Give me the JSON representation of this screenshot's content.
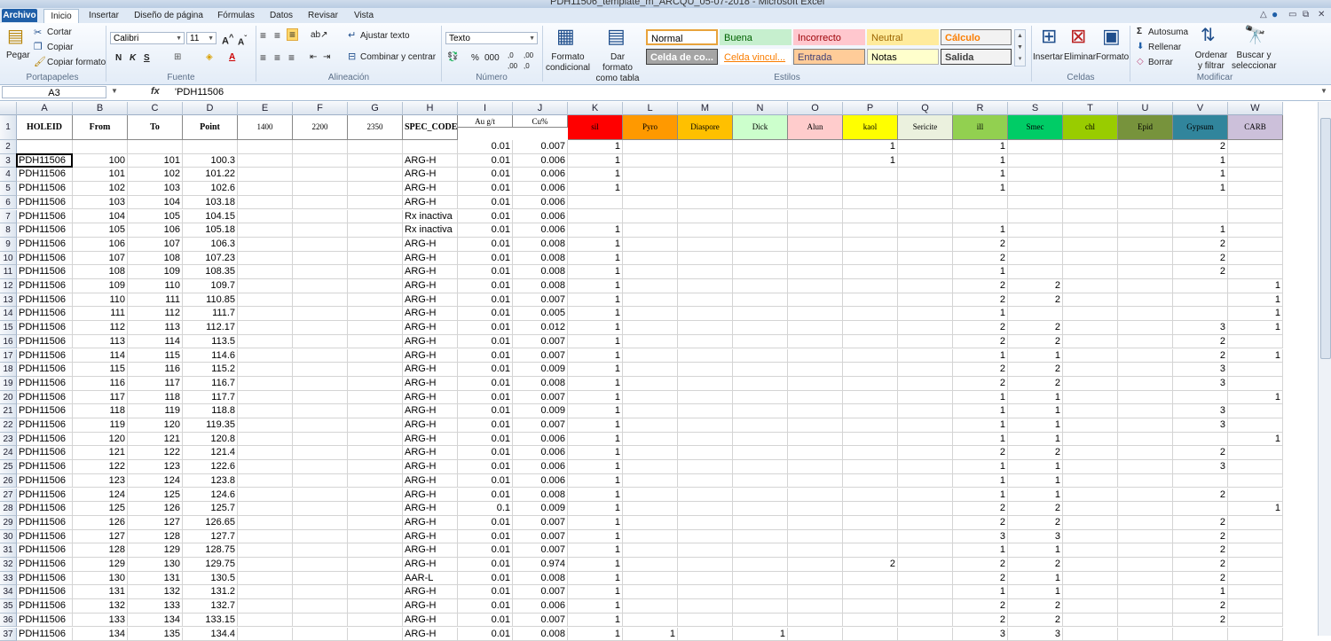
{
  "window": {
    "title": "PDH11506_template_m_ARCQU_05-07-2018 - Microsoft Excel"
  },
  "ribbon_tabs": [
    "Archivo",
    "Inicio",
    "Insertar",
    "Diseño de página",
    "Fórmulas",
    "Datos",
    "Revisar",
    "Vista"
  ],
  "ribbon": {
    "clipboard": {
      "paste": "Pegar",
      "cut": "Cortar",
      "copy": "Copiar",
      "format_painter": "Copiar formato",
      "group": "Portapapeles"
    },
    "font": {
      "name": "Calibri",
      "size": "11",
      "group": "Fuente"
    },
    "alignment": {
      "wrap": "Ajustar texto",
      "merge": "Combinar y centrar",
      "group": "Alineación"
    },
    "number": {
      "format": "Texto",
      "percent": "%",
      "thousands": "000",
      "group": "Número"
    },
    "styles": {
      "cond_format": "Formato condicional",
      "table_format": "Dar formato como tabla",
      "group": "Estilos",
      "cells": [
        {
          "label": "Normal",
          "bg": "#ffffff",
          "fg": "#000000",
          "border": "#e8a33c"
        },
        {
          "label": "Buena",
          "bg": "#c6efce",
          "fg": "#006100",
          "border": "#c6efce"
        },
        {
          "label": "Incorrecto",
          "bg": "#ffc7ce",
          "fg": "#9c0006",
          "border": "#ffc7ce"
        },
        {
          "label": "Neutral",
          "bg": "#ffeb9c",
          "fg": "#9c6500",
          "border": "#ffeb9c"
        },
        {
          "label": "Cálculo",
          "bg": "#f2f2f2",
          "fg": "#fa7d00",
          "border": "#7f7f7f"
        },
        {
          "label": "Celda de co...",
          "bg": "#a5a5a5",
          "fg": "#ffffff",
          "border": "#3f3f3f"
        },
        {
          "label": "Celda vincul...",
          "bg": "#ffffff",
          "fg": "#fa7d00",
          "border": "#ffffff"
        },
        {
          "label": "Entrada",
          "bg": "#ffcc99",
          "fg": "#3f3f76",
          "border": "#7f7f7f"
        },
        {
          "label": "Notas",
          "bg": "#ffffcc",
          "fg": "#000000",
          "border": "#b2b2b2"
        },
        {
          "label": "Salida",
          "bg": "#f2f2f2",
          "fg": "#3f3f3f",
          "border": "#3f3f3f"
        }
      ]
    },
    "cells_group": {
      "insert": "Insertar",
      "delete": "Eliminar",
      "format": "Formato",
      "group": "Celdas"
    },
    "editing": {
      "autosum": "Autosuma",
      "fill": "Rellenar",
      "clear": "Borrar",
      "sort": "Ordenar y filtrar",
      "find": "Buscar y seleccionar",
      "group": "Modificar"
    }
  },
  "formula_bar": {
    "name_box": "A3",
    "fx": "fx",
    "content": "'PDH11506"
  },
  "columns": [
    "A",
    "B",
    "C",
    "D",
    "E",
    "F",
    "G",
    "H",
    "I",
    "J",
    "K",
    "L",
    "M",
    "N",
    "O",
    "P",
    "Q",
    "R",
    "S",
    "T",
    "U",
    "V",
    "W"
  ],
  "header_row": [
    "HOLEID",
    "From",
    "To",
    "Point",
    "1400",
    "2200",
    "2350",
    "SPEC_CODE",
    "Au g/t",
    "Cu%",
    "sil",
    "Pyro",
    "Diaspore",
    "Dick",
    "Alun",
    "kaol",
    "Sericite",
    "ill",
    "Smec",
    "chl",
    "Epid",
    "Gypsum",
    "CARB"
  ],
  "header_colors": {
    "K": "#ff0000",
    "L": "#ff9900",
    "M": "#ffc000",
    "N": "#ccffcc",
    "O": "#ffcccc",
    "P": "#ffff00",
    "Q": "#ebf1de",
    "R": "#92d050",
    "S": "#00cc66",
    "T": "#99cc00",
    "U": "#77933c",
    "V": "#31859c",
    "W": "#ccc0da"
  },
  "row2": {
    "I": "0.01",
    "J": "0.007",
    "K": "1",
    "P": "1",
    "R": "1",
    "V": "2"
  },
  "rows": [
    {
      "A": "PDH11506",
      "B": "100",
      "C": "101",
      "D": "100.3",
      "H": "ARG-H",
      "I": "0.01",
      "J": "0.006",
      "K": "1",
      "P": "1",
      "R": "1",
      "V": "1"
    },
    {
      "A": "PDH11506",
      "B": "101",
      "C": "102",
      "D": "101.22",
      "H": "ARG-H",
      "I": "0.01",
      "J": "0.006",
      "K": "1",
      "R": "1",
      "V": "1"
    },
    {
      "A": "PDH11506",
      "B": "102",
      "C": "103",
      "D": "102.6",
      "H": "ARG-H",
      "I": "0.01",
      "J": "0.006",
      "K": "1",
      "R": "1",
      "V": "1"
    },
    {
      "A": "PDH11506",
      "B": "103",
      "C": "104",
      "D": "103.18",
      "H": "ARG-H",
      "I": "0.01",
      "J": "0.006"
    },
    {
      "A": "PDH11506",
      "B": "104",
      "C": "105",
      "D": "104.15",
      "H": "Rx inactiva",
      "I": "0.01",
      "J": "0.006"
    },
    {
      "A": "PDH11506",
      "B": "105",
      "C": "106",
      "D": "105.18",
      "H": "Rx inactiva",
      "I": "0.01",
      "J": "0.006",
      "K": "1",
      "R": "1",
      "V": "1"
    },
    {
      "A": "PDH11506",
      "B": "106",
      "C": "107",
      "D": "106.3",
      "H": "ARG-H",
      "I": "0.01",
      "J": "0.008",
      "K": "1",
      "R": "2",
      "V": "2"
    },
    {
      "A": "PDH11506",
      "B": "107",
      "C": "108",
      "D": "107.23",
      "H": "ARG-H",
      "I": "0.01",
      "J": "0.008",
      "K": "1",
      "R": "2",
      "V": "2"
    },
    {
      "A": "PDH11506",
      "B": "108",
      "C": "109",
      "D": "108.35",
      "H": "ARG-H",
      "I": "0.01",
      "J": "0.008",
      "K": "1",
      "R": "1",
      "V": "2"
    },
    {
      "A": "PDH11506",
      "B": "109",
      "C": "110",
      "D": "109.7",
      "H": "ARG-H",
      "I": "0.01",
      "J": "0.008",
      "K": "1",
      "R": "2",
      "S": "2",
      "W": "1"
    },
    {
      "A": "PDH11506",
      "B": "110",
      "C": "111",
      "D": "110.85",
      "H": "ARG-H",
      "I": "0.01",
      "J": "0.007",
      "K": "1",
      "R": "2",
      "S": "2",
      "W": "1"
    },
    {
      "A": "PDH11506",
      "B": "111",
      "C": "112",
      "D": "111.7",
      "H": "ARG-H",
      "I": "0.01",
      "J": "0.005",
      "K": "1",
      "R": "1",
      "W": "1"
    },
    {
      "A": "PDH11506",
      "B": "112",
      "C": "113",
      "D": "112.17",
      "H": "ARG-H",
      "I": "0.01",
      "J": "0.012",
      "K": "1",
      "R": "2",
      "S": "2",
      "V": "3",
      "W": "1"
    },
    {
      "A": "PDH11506",
      "B": "113",
      "C": "114",
      "D": "113.5",
      "H": "ARG-H",
      "I": "0.01",
      "J": "0.007",
      "K": "1",
      "R": "2",
      "S": "2",
      "V": "2"
    },
    {
      "A": "PDH11506",
      "B": "114",
      "C": "115",
      "D": "114.6",
      "H": "ARG-H",
      "I": "0.01",
      "J": "0.007",
      "K": "1",
      "R": "1",
      "S": "1",
      "V": "2",
      "W": "1"
    },
    {
      "A": "PDH11506",
      "B": "115",
      "C": "116",
      "D": "115.2",
      "H": "ARG-H",
      "I": "0.01",
      "J": "0.009",
      "K": "1",
      "R": "2",
      "S": "2",
      "V": "3"
    },
    {
      "A": "PDH11506",
      "B": "116",
      "C": "117",
      "D": "116.7",
      "H": "ARG-H",
      "I": "0.01",
      "J": "0.008",
      "K": "1",
      "R": "2",
      "S": "2",
      "V": "3"
    },
    {
      "A": "PDH11506",
      "B": "117",
      "C": "118",
      "D": "117.7",
      "H": "ARG-H",
      "I": "0.01",
      "J": "0.007",
      "K": "1",
      "R": "1",
      "S": "1",
      "W": "1"
    },
    {
      "A": "PDH11506",
      "B": "118",
      "C": "119",
      "D": "118.8",
      "H": "ARG-H",
      "I": "0.01",
      "J": "0.009",
      "K": "1",
      "R": "1",
      "S": "1",
      "V": "3"
    },
    {
      "A": "PDH11506",
      "B": "119",
      "C": "120",
      "D": "119.35",
      "H": "ARG-H",
      "I": "0.01",
      "J": "0.007",
      "K": "1",
      "R": "1",
      "S": "1",
      "V": "3"
    },
    {
      "A": "PDH11506",
      "B": "120",
      "C": "121",
      "D": "120.8",
      "H": "ARG-H",
      "I": "0.01",
      "J": "0.006",
      "K": "1",
      "R": "1",
      "S": "1",
      "W": "1"
    },
    {
      "A": "PDH11506",
      "B": "121",
      "C": "122",
      "D": "121.4",
      "H": "ARG-H",
      "I": "0.01",
      "J": "0.006",
      "K": "1",
      "R": "2",
      "S": "2",
      "V": "2"
    },
    {
      "A": "PDH11506",
      "B": "122",
      "C": "123",
      "D": "122.6",
      "H": "ARG-H",
      "I": "0.01",
      "J": "0.006",
      "K": "1",
      "R": "1",
      "S": "1",
      "V": "3"
    },
    {
      "A": "PDH11506",
      "B": "123",
      "C": "124",
      "D": "123.8",
      "H": "ARG-H",
      "I": "0.01",
      "J": "0.006",
      "K": "1",
      "R": "1",
      "S": "1"
    },
    {
      "A": "PDH11506",
      "B": "124",
      "C": "125",
      "D": "124.6",
      "H": "ARG-H",
      "I": "0.01",
      "J": "0.008",
      "K": "1",
      "R": "1",
      "S": "1",
      "V": "2"
    },
    {
      "A": "PDH11506",
      "B": "125",
      "C": "126",
      "D": "125.7",
      "H": "ARG-H",
      "I": "0.1",
      "J": "0.009",
      "K": "1",
      "R": "2",
      "S": "2",
      "W": "1"
    },
    {
      "A": "PDH11506",
      "B": "126",
      "C": "127",
      "D": "126.65",
      "H": "ARG-H",
      "I": "0.01",
      "J": "0.007",
      "K": "1",
      "R": "2",
      "S": "2",
      "V": "2"
    },
    {
      "A": "PDH11506",
      "B": "127",
      "C": "128",
      "D": "127.7",
      "H": "ARG-H",
      "I": "0.01",
      "J": "0.007",
      "K": "1",
      "R": "3",
      "S": "3",
      "V": "2"
    },
    {
      "A": "PDH11506",
      "B": "128",
      "C": "129",
      "D": "128.75",
      "H": "ARG-H",
      "I": "0.01",
      "J": "0.007",
      "K": "1",
      "R": "1",
      "S": "1",
      "V": "2"
    },
    {
      "A": "PDH11506",
      "B": "129",
      "C": "130",
      "D": "129.75",
      "H": "ARG-H",
      "I": "0.01",
      "J": "0.974",
      "K": "1",
      "P": "2",
      "R": "2",
      "S": "2",
      "V": "2"
    },
    {
      "A": "PDH11506",
      "B": "130",
      "C": "131",
      "D": "130.5",
      "H": "AAR-L",
      "I": "0.01",
      "J": "0.008",
      "K": "1",
      "R": "2",
      "S": "1",
      "V": "2"
    },
    {
      "A": "PDH11506",
      "B": "131",
      "C": "132",
      "D": "131.2",
      "H": "ARG-H",
      "I": "0.01",
      "J": "0.007",
      "K": "1",
      "R": "1",
      "S": "1",
      "V": "1"
    },
    {
      "A": "PDH11506",
      "B": "132",
      "C": "133",
      "D": "132.7",
      "H": "ARG-H",
      "I": "0.01",
      "J": "0.006",
      "K": "1",
      "R": "2",
      "S": "2",
      "V": "2"
    },
    {
      "A": "PDH11506",
      "B": "133",
      "C": "134",
      "D": "133.15",
      "H": "ARG-H",
      "I": "0.01",
      "J": "0.007",
      "K": "1",
      "R": "2",
      "S": "2",
      "V": "2"
    },
    {
      "A": "PDH11506",
      "B": "134",
      "C": "135",
      "D": "134.4",
      "H": "ARG-H",
      "I": "0.01",
      "J": "0.008",
      "K": "1",
      "L": "1",
      "N": "1",
      "R": "3",
      "S": "3"
    }
  ]
}
